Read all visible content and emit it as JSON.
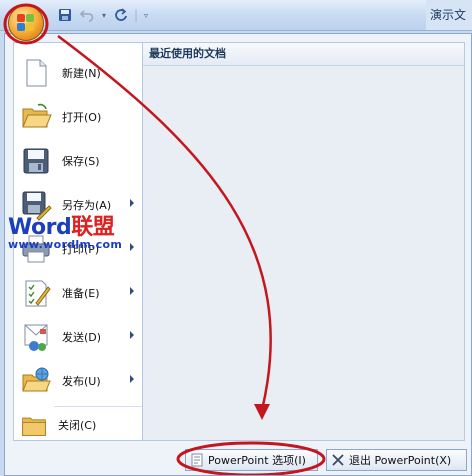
{
  "titlebar": {
    "app_title": "演示文",
    "qat": {
      "save": "save-icon",
      "undo": "undo-icon",
      "redo": "redo-icon",
      "customize": "dropdown-icon"
    }
  },
  "menu": {
    "items": [
      {
        "label": "新建(N)",
        "icon": "new-document-icon",
        "has_submenu": false
      },
      {
        "label": "打开(O)",
        "icon": "open-folder-icon",
        "has_submenu": false
      },
      {
        "label": "保存(S)",
        "icon": "save-icon",
        "has_submenu": false
      },
      {
        "label": "另存为(A)",
        "icon": "save-as-icon",
        "has_submenu": true
      },
      {
        "label": "打印(P)",
        "icon": "print-icon",
        "has_submenu": true
      },
      {
        "label": "准备(E)",
        "icon": "prepare-icon",
        "has_submenu": true
      },
      {
        "label": "发送(D)",
        "icon": "send-icon",
        "has_submenu": true
      },
      {
        "label": "发布(U)",
        "icon": "publish-icon",
        "has_submenu": true
      },
      {
        "label": "关闭(C)",
        "icon": "close-folder-icon",
        "has_submenu": false
      }
    ]
  },
  "recent": {
    "header": "最近使用的文档"
  },
  "buttons": {
    "options_label": "PowerPoint 选项(I)",
    "exit_label": "退出 PowerPoint(X)"
  },
  "watermark": {
    "word": "Word",
    "cn": "联盟",
    "url": "www.wordlm.com"
  },
  "colors": {
    "annotation_red": "#c4161c",
    "accent": "#1e395b",
    "watermark_blue": "#1b3fbf"
  }
}
